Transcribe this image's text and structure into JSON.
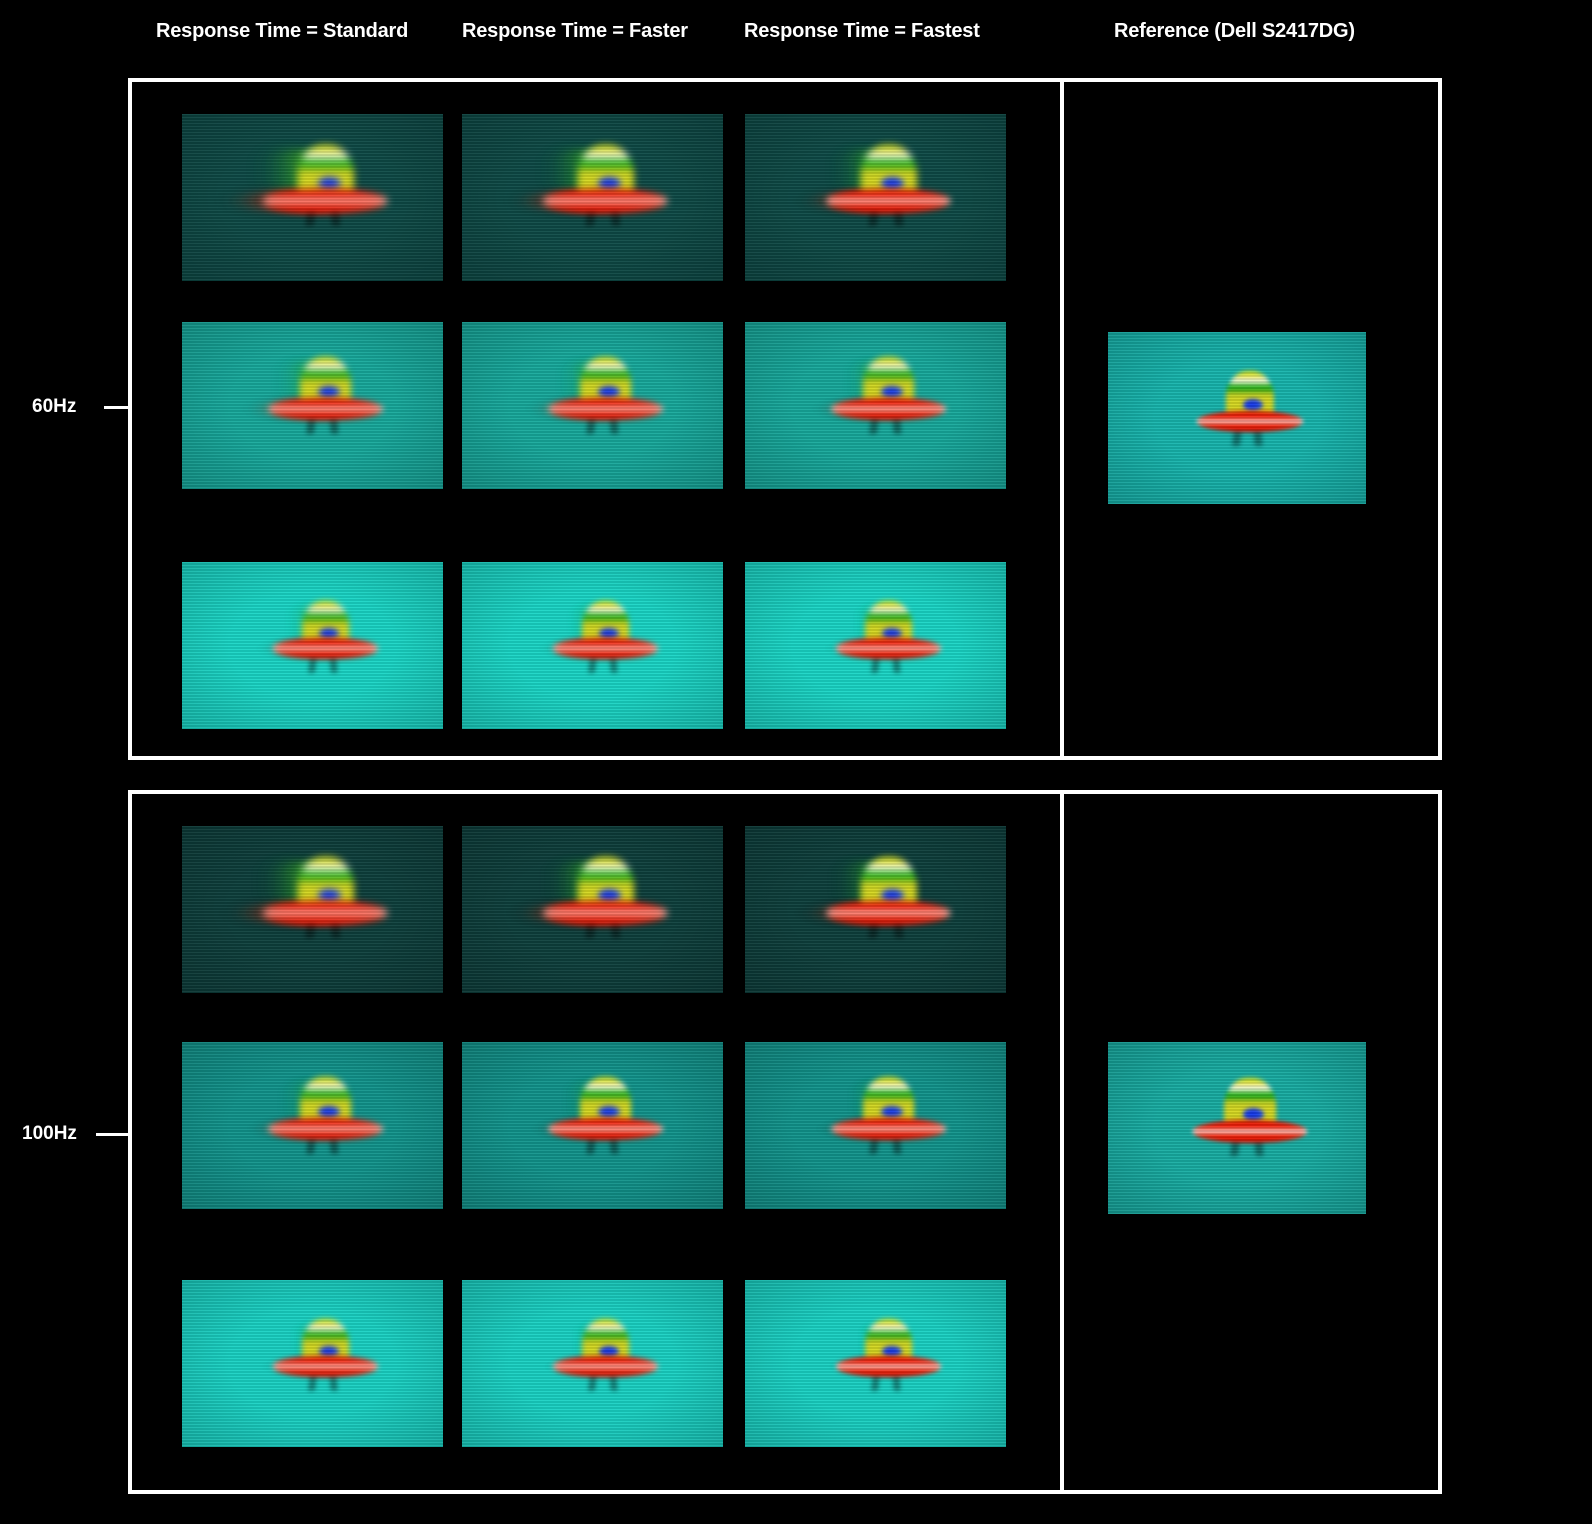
{
  "page": {
    "title": "Monitor response time pursuit-camera comparison",
    "background_color": "#000000",
    "frame_color": "#ffffff"
  },
  "columns": [
    {
      "id": "standard",
      "label": "Response Time = Standard"
    },
    {
      "id": "faster",
      "label": "Response Time = Faster"
    },
    {
      "id": "fastest",
      "label": "Response Time = Fastest"
    },
    {
      "id": "reference",
      "label": "Reference (Dell S2417DG)"
    }
  ],
  "panels": [
    {
      "id": "60hz",
      "refresh_label": "60Hz"
    },
    {
      "id": "100hz",
      "refresh_label": "100Hz"
    }
  ],
  "rows": [
    {
      "id": "dark",
      "background_color": "#0d4a46"
    },
    {
      "id": "medium",
      "background_color": "#16a99c"
    },
    {
      "id": "light",
      "background_color": "#19d6c6"
    }
  ],
  "ufo": {
    "dome_colors": [
      "#d8e000",
      "#ffffff",
      "#1fb814",
      "#cfd820"
    ],
    "body_colors": [
      "#e81200",
      "#ffffff"
    ],
    "window_color": "#1030ee",
    "leg_color": "rgba(0,0,0,0.4)"
  },
  "cells": [
    {
      "panel": "60hz",
      "column": "standard",
      "row": "dark",
      "ghost_strength": 0.85,
      "background_color": "#0d4a46"
    },
    {
      "panel": "60hz",
      "column": "faster",
      "row": "dark",
      "ghost_strength": 0.72,
      "background_color": "#0d4a46"
    },
    {
      "panel": "60hz",
      "column": "fastest",
      "row": "dark",
      "ghost_strength": 0.62,
      "background_color": "#0d4a46"
    },
    {
      "panel": "60hz",
      "column": "standard",
      "row": "medium",
      "ghost_strength": 0.55,
      "background_color": "#16a99c"
    },
    {
      "panel": "60hz",
      "column": "faster",
      "row": "medium",
      "ghost_strength": 0.48,
      "background_color": "#16a99c"
    },
    {
      "panel": "60hz",
      "column": "fastest",
      "row": "medium",
      "ghost_strength": 0.42,
      "background_color": "#16a99c"
    },
    {
      "panel": "60hz",
      "column": "standard",
      "row": "light",
      "ghost_strength": 0.4,
      "background_color": "#19d6c6"
    },
    {
      "panel": "60hz",
      "column": "faster",
      "row": "light",
      "ghost_strength": 0.36,
      "background_color": "#19d6c6"
    },
    {
      "panel": "60hz",
      "column": "fastest",
      "row": "light",
      "ghost_strength": 0.3,
      "background_color": "#19d6c6"
    },
    {
      "panel": "60hz",
      "column": "reference",
      "row": "medium",
      "ghost_strength": 0.1,
      "background_color": "#16b5ad"
    },
    {
      "panel": "100hz",
      "column": "standard",
      "row": "dark",
      "ghost_strength": 0.78,
      "background_color": "#0d3f3c"
    },
    {
      "panel": "100hz",
      "column": "faster",
      "row": "dark",
      "ghost_strength": 0.66,
      "background_color": "#0d3f3c"
    },
    {
      "panel": "100hz",
      "column": "fastest",
      "row": "dark",
      "ghost_strength": 0.58,
      "background_color": "#0d3f3c"
    },
    {
      "panel": "100hz",
      "column": "standard",
      "row": "medium",
      "ghost_strength": 0.44,
      "background_color": "#11948c"
    },
    {
      "panel": "100hz",
      "column": "faster",
      "row": "medium",
      "ghost_strength": 0.38,
      "background_color": "#11948c"
    },
    {
      "panel": "100hz",
      "column": "fastest",
      "row": "medium",
      "ghost_strength": 0.34,
      "background_color": "#11948c"
    },
    {
      "panel": "100hz",
      "column": "standard",
      "row": "light",
      "ghost_strength": 0.3,
      "background_color": "#19d2c4"
    },
    {
      "panel": "100hz",
      "column": "faster",
      "row": "light",
      "ghost_strength": 0.26,
      "background_color": "#19d2c4"
    },
    {
      "panel": "100hz",
      "column": "fastest",
      "row": "light",
      "ghost_strength": 0.22,
      "background_color": "#19d2c4"
    },
    {
      "panel": "100hz",
      "column": "reference",
      "row": "medium",
      "ghost_strength": 0.08,
      "background_color": "#17ada3"
    }
  ]
}
